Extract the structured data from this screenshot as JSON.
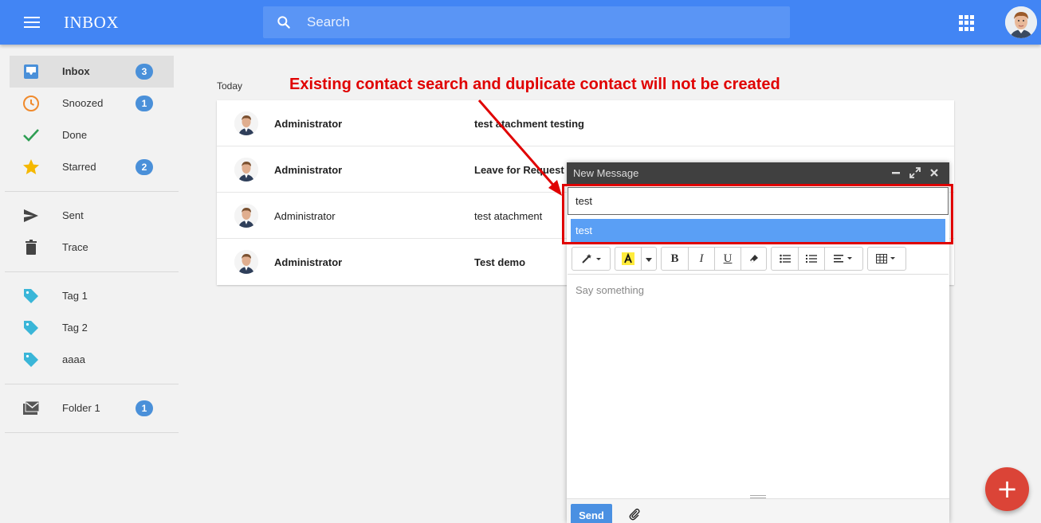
{
  "app": {
    "title": "INBOX"
  },
  "search": {
    "placeholder": "Search"
  },
  "sidebar": {
    "items": [
      {
        "label": "Inbox",
        "badge": "3",
        "icon": "inbox-icon"
      },
      {
        "label": "Snoozed",
        "badge": "1",
        "icon": "clock-icon"
      },
      {
        "label": "Done",
        "icon": "check-icon"
      },
      {
        "label": "Starred",
        "badge": "2",
        "icon": "star-icon"
      },
      {
        "label": "Sent",
        "icon": "send-icon"
      },
      {
        "label": "Trace",
        "icon": "trash-icon"
      },
      {
        "label": "Tag 1",
        "icon": "tag-icon"
      },
      {
        "label": "Tag 2",
        "icon": "tag-icon"
      },
      {
        "label": "aaaa",
        "icon": "tag-icon"
      },
      {
        "label": "Folder 1",
        "badge": "1",
        "icon": "folder-mail-icon"
      }
    ]
  },
  "mail": {
    "section": "Today",
    "rows": [
      {
        "sender": "Administrator",
        "subject": "test atachment testing",
        "unread": true
      },
      {
        "sender": "Administrator",
        "subject": "Leave for Request",
        "unread": true
      },
      {
        "sender": "Administrator",
        "subject": "test atachment",
        "unread": false
      },
      {
        "sender": "Administrator",
        "subject": "Test demo",
        "unread": true
      }
    ]
  },
  "annotation": "Existing contact search and duplicate contact will not be created",
  "compose": {
    "title": "New Message",
    "to_value": "test",
    "suggestion": "test",
    "body_placeholder": "Say something",
    "send_label": "Send"
  },
  "colors": {
    "topbar": "#4285f4",
    "badge": "#4a90d9",
    "fab": "#db4437",
    "annotation": "#e00000",
    "suggestion": "#5a9ff5"
  }
}
